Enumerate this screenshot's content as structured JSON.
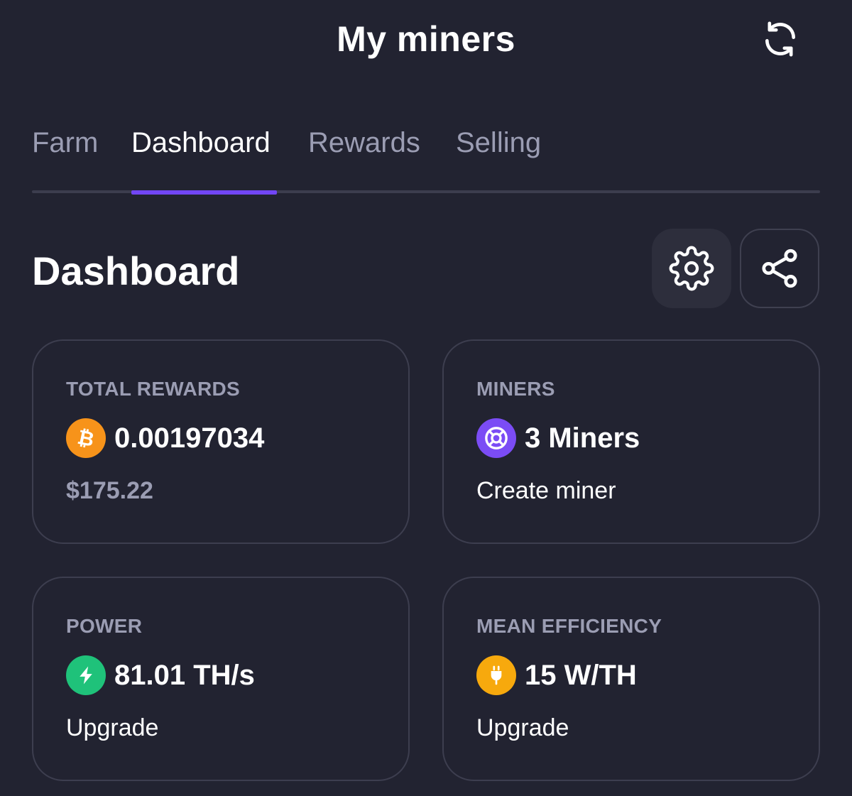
{
  "header": {
    "title": "My miners",
    "refresh_icon": "refresh-icon"
  },
  "tabs": [
    {
      "label": "Farm",
      "active": false
    },
    {
      "label": "Dashboard",
      "active": true
    },
    {
      "label": "Rewards",
      "active": false
    },
    {
      "label": "Selling",
      "active": false
    }
  ],
  "section": {
    "title": "Dashboard",
    "settings_icon": "gear-icon",
    "share_icon": "share-icon"
  },
  "cards": {
    "total_rewards": {
      "label": "TOTAL REWARDS",
      "value": "0.00197034",
      "sub": "$175.22",
      "icon": "bitcoin-icon"
    },
    "miners": {
      "label": "MINERS",
      "value": "3 Miners",
      "sub": "Create miner",
      "icon": "miner-icon"
    },
    "power": {
      "label": "POWER",
      "value": "81.01 TH/s",
      "sub": "Upgrade",
      "icon": "lightning-icon"
    },
    "mean_efficiency": {
      "label": "MEAN EFFICIENCY",
      "value": "15 W/TH",
      "sub": "Upgrade",
      "icon": "plug-icon"
    }
  },
  "colors": {
    "background": "#222331",
    "accent": "#7246f5",
    "bitcoin": "#f7931a",
    "miner": "#7b4cf5",
    "power": "#1fc27a",
    "efficiency": "#f7a90d",
    "muted_text": "#9b9db3"
  }
}
